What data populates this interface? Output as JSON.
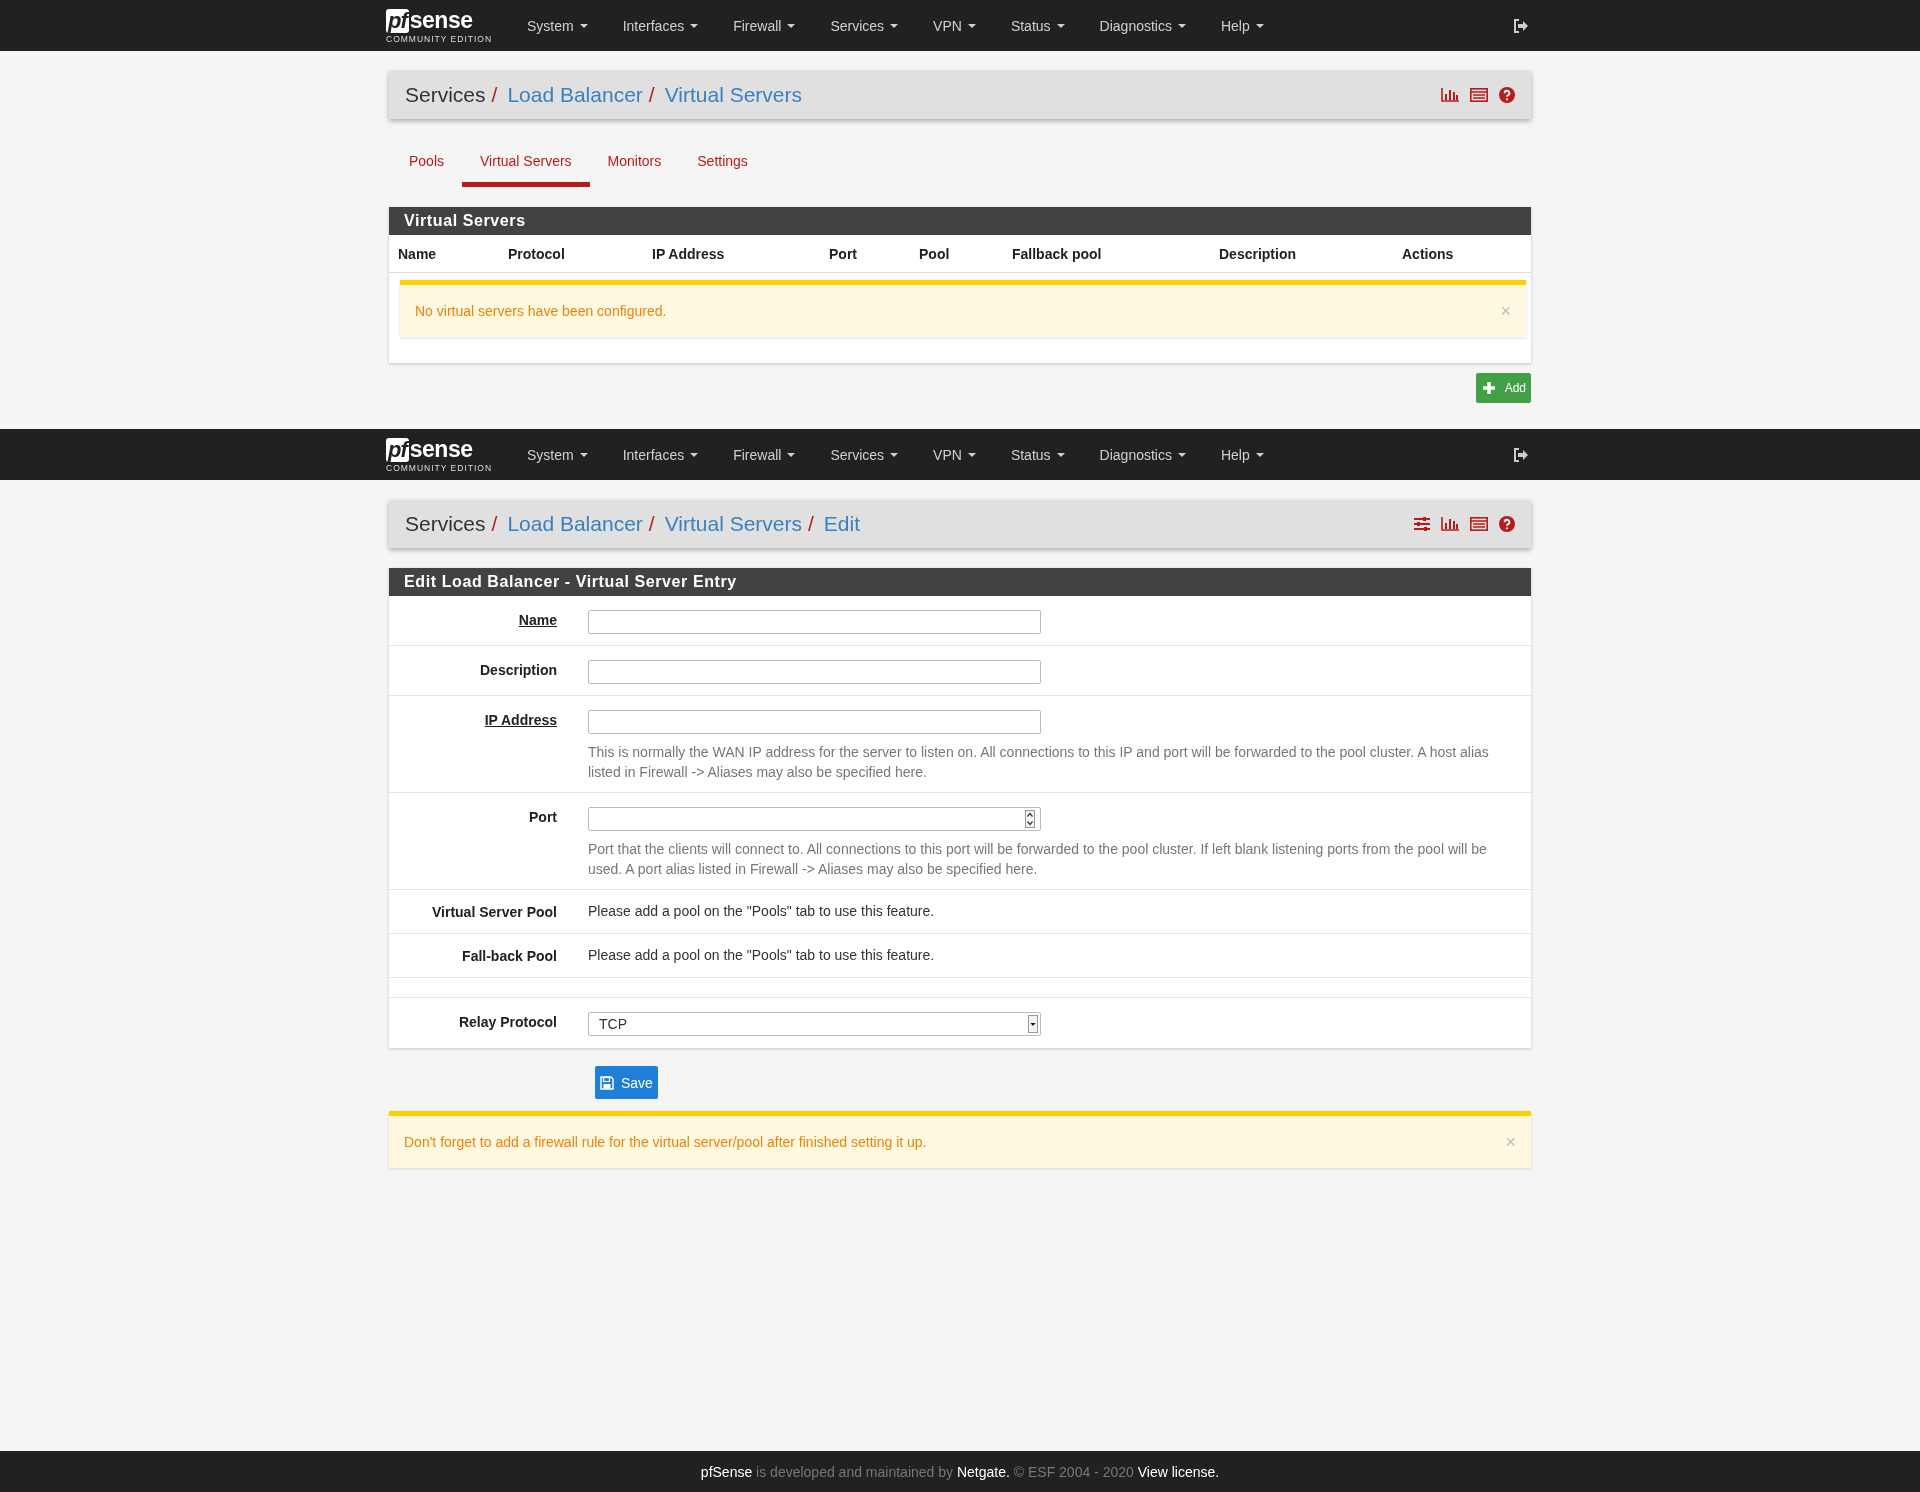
{
  "pages": [
    {
      "navbar": {
        "logo_mark": "pf",
        "logo_text": "sense",
        "edition": "COMMUNITY EDITION",
        "menu": [
          "System",
          "Interfaces",
          "Firewall",
          "Services",
          "VPN",
          "Status",
          "Diagnostics",
          "Help"
        ]
      },
      "breadcrumb": [
        {
          "label": "Services",
          "link": false
        },
        {
          "separator": "/",
          "label": "Load Balancer",
          "link": true
        },
        {
          "separator": "/",
          "label": "Virtual Servers",
          "link": true
        }
      ],
      "tabs": [
        {
          "label": "Pools",
          "selected": false
        },
        {
          "label": "Virtual Servers",
          "selected": true
        },
        {
          "label": "Monitors",
          "selected": false
        },
        {
          "label": "Settings",
          "selected": false
        }
      ],
      "table": {
        "title": "Virtual Servers",
        "columns": [
          "Name",
          "Protocol",
          "IP Address",
          "Port",
          "Pool",
          "Fallback pool",
          "Description",
          "Actions"
        ],
        "alert": "No virtual servers have been configured.",
        "alert_close": "×"
      },
      "add_button": "Add"
    },
    {
      "navbar": {
        "logo_mark": "pf",
        "logo_text": "sense",
        "edition": "COMMUNITY EDITION",
        "menu": [
          "System",
          "Interfaces",
          "Firewall",
          "Services",
          "VPN",
          "Status",
          "Diagnostics",
          "Help"
        ]
      },
      "breadcrumb": [
        {
          "label": "Services",
          "link": false
        },
        {
          "separator": "/",
          "label": "Load Balancer",
          "link": true
        },
        {
          "separator": "/",
          "label": "Virtual Servers",
          "link": true
        },
        {
          "separator": "/",
          "label": "Edit",
          "link": true
        }
      ],
      "form": {
        "title": "Edit Load Balancer - Virtual Server Entry",
        "fields": [
          {
            "kind": "text",
            "label": "Name",
            "required": true
          },
          {
            "kind": "text",
            "label": "Description",
            "required": false
          },
          {
            "kind": "text",
            "label": "IP Address",
            "required": true,
            "help": "This is normally the WAN IP address for the server to listen on. All connections to this IP and port will be forwarded to the pool cluster. A host alias listed in Firewall -> Aliases may also be specified here."
          },
          {
            "kind": "number",
            "label": "Port",
            "required": false,
            "help": "Port that the clients will connect to. All connections to this port will be forwarded to the pool cluster. If left blank listening ports from the pool will be used. A port alias listed in Firewall -> Aliases may also be specified here."
          },
          {
            "kind": "note",
            "label": "Virtual Server Pool",
            "required": false,
            "text": "Please add a pool on the \"Pools\" tab to use this feature."
          },
          {
            "kind": "note",
            "label": "Fall-back Pool",
            "required": false,
            "text": "Please add a pool on the \"Pools\" tab to use this feature."
          },
          {
            "kind": "spacer"
          },
          {
            "kind": "select",
            "label": "Relay Protocol",
            "required": false,
            "value": "TCP"
          }
        ],
        "save_button": "Save"
      },
      "alert": "Don't forget to add a firewall rule for the virtual server/pool after finished setting it up.",
      "alert_close": "×"
    }
  ],
  "footer": [
    {
      "kind": "link",
      "text": "pfSense"
    },
    {
      "kind": "text",
      "text": " is developed and maintained by "
    },
    {
      "kind": "link",
      "text": "Netgate."
    },
    {
      "kind": "text",
      "text": " © ESF 2004 - 2020 "
    },
    {
      "kind": "link",
      "text": "View license."
    }
  ]
}
